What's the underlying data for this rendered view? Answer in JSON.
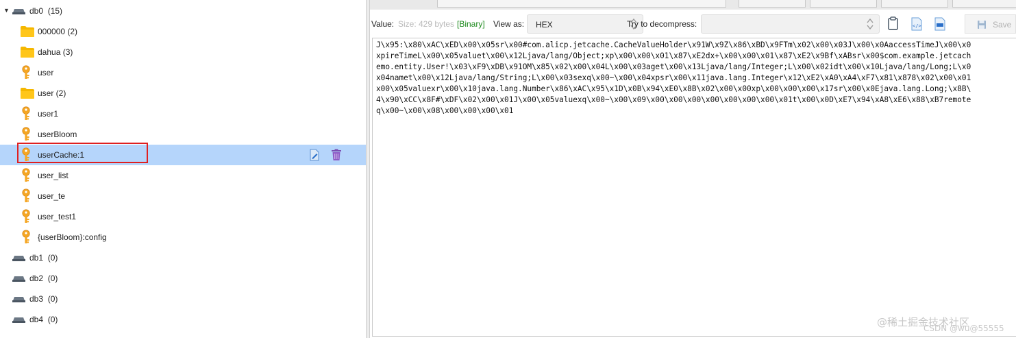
{
  "tree": {
    "db0": {
      "label": "db0",
      "count": "(15)"
    },
    "items": [
      {
        "label": "000000 (2)",
        "type": "folder"
      },
      {
        "label": "dahua (3)",
        "type": "folder"
      },
      {
        "label": "user",
        "type": "key"
      },
      {
        "label": "user (2)",
        "type": "folder"
      },
      {
        "label": "user1",
        "type": "key"
      },
      {
        "label": "userBloom",
        "type": "key"
      },
      {
        "label": "userCache:1",
        "type": "key",
        "selected": true
      },
      {
        "label": "user_list",
        "type": "key"
      },
      {
        "label": "user_te",
        "type": "key"
      },
      {
        "label": "user_test1",
        "type": "key"
      },
      {
        "label": "{userBloom}:config",
        "type": "key"
      }
    ],
    "dbs": [
      {
        "label": "db1",
        "count": "(0)"
      },
      {
        "label": "db2",
        "count": "(0)"
      },
      {
        "label": "db3",
        "count": "(0)"
      },
      {
        "label": "db4",
        "count": "(0)"
      }
    ]
  },
  "viewer": {
    "value_label": "Value:",
    "size_text": "Size: 429 bytes",
    "binary_text": "[Binary]",
    "view_as_label": "View as:",
    "view_as_value": "HEX",
    "decompress_label": "Try to decompress:",
    "decompress_value": "",
    "save_label": "Save",
    "lines": [
      "J\\x95:\\x80\\xAC\\xED\\x00\\x05sr\\x00#com.alicp.jetcache.CacheValueHolder\\x91W\\x9Z\\x86\\xBD\\x9FTm\\x02\\x00\\x03J\\x00\\x0AaccessTimeJ\\x00\\x0",
      "xpireTimeL\\x00\\x05valuet\\x00\\x12Ljava/lang/Object;xp\\x00\\x00\\x01\\x87\\xE2dx+\\x00\\x00\\x01\\x87\\xE2\\x9Bf\\xABsr\\x00$com.example.jetcach",
      "emo.entity.User!\\x03\\xF9\\xDB\\x91OM\\x85\\x02\\x00\\x04L\\x00\\x03aget\\x00\\x13Ljava/lang/Integer;L\\x00\\x02idt\\x00\\x10Ljava/lang/Long;L\\x0",
      "x04namet\\x00\\x12Ljava/lang/String;L\\x00\\x03sexq\\x00~\\x00\\x04xpsr\\x00\\x11java.lang.Integer\\x12\\xE2\\xA0\\xA4\\xF7\\x81\\x878\\x02\\x00\\x01",
      "x00\\x05valuexr\\x00\\x10java.lang.Number\\x86\\xAC\\x95\\x1D\\x0B\\x94\\xE0\\x8B\\x02\\x00\\x00xp\\x00\\x00\\x00\\x17sr\\x00\\x0Ejava.lang.Long;\\x8B\\",
      "4\\x90\\xCC\\x8F#\\xDF\\x02\\x00\\x01J\\x00\\x05valuexq\\x00~\\x00\\x09\\x00\\x00\\x00\\x00\\x00\\x00\\x00\\x01t\\x00\\x0D\\xE7\\x94\\xA8\\xE6\\x88\\xB7remote",
      "q\\x00~\\x00\\x08\\x00\\x00\\x00\\x01"
    ]
  },
  "watermarks": {
    "top": "@稀土掘金技术社区",
    "bottom": "CSDN @wu@55555"
  },
  "colors": {
    "selected_row": "#b5d5fb",
    "highlight_border": "#e02020",
    "key_icon": "#f5a623",
    "folder_icon": "#f5b700"
  }
}
